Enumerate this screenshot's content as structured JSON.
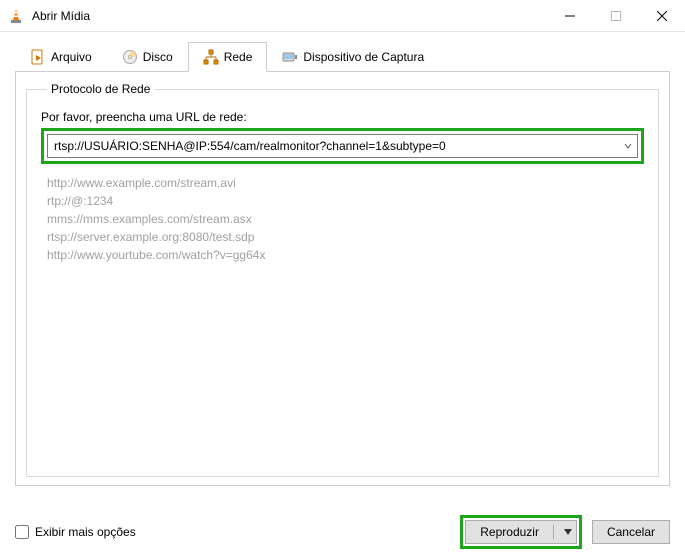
{
  "window": {
    "title": "Abrir Mídia"
  },
  "tabs": {
    "file": "Arquivo",
    "disc": "Disco",
    "network": "Rede",
    "capture": "Dispositivo de Captura"
  },
  "network": {
    "legend": "Protocolo de Rede",
    "prompt": "Por favor, preencha uma URL de rede:",
    "url_value": "rtsp://USUÁRIO:SENHA@IP:554/cam/realmonitor?channel=1&subtype=0",
    "examples": {
      "e1": "http://www.example.com/stream.avi",
      "e2": "rtp://@:1234",
      "e3": "mms://mms.examples.com/stream.asx",
      "e4": "rtsp://server.example.org:8080/test.sdp",
      "e5": "http://www.yourtube.com/watch?v=gg64x"
    }
  },
  "footer": {
    "more_options": "Exibir mais opções",
    "play": "Reproduzir",
    "cancel": "Cancelar"
  }
}
